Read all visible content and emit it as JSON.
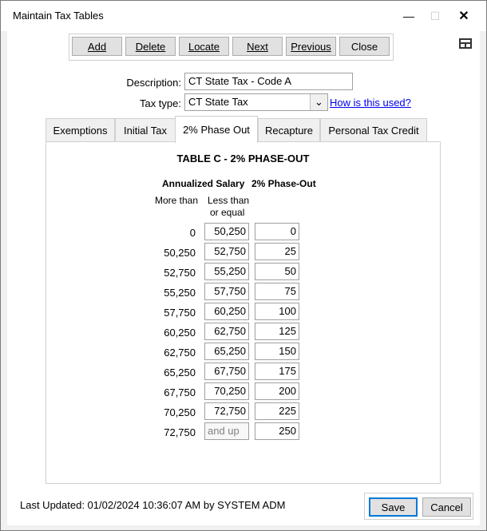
{
  "window": {
    "title": "Maintain Tax Tables"
  },
  "toolbar": {
    "add": "Add",
    "delete": "Delete",
    "locate": "Locate",
    "next": "Next",
    "previous": "Previous",
    "close": "Close"
  },
  "form": {
    "description_label": "Description:",
    "description_value": "CT State Tax - Code A",
    "tax_type_label": "Tax type:",
    "tax_type_value": "CT State Tax",
    "help_link": "How is this used?"
  },
  "tabs": [
    {
      "label": "Exemptions",
      "active": false
    },
    {
      "label": "Initial Tax",
      "active": false
    },
    {
      "label": "2% Phase Out",
      "active": true
    },
    {
      "label": "Recapture",
      "active": false
    },
    {
      "label": "Personal Tax Credit",
      "active": false
    }
  ],
  "table": {
    "title": "TABLE C - 2% PHASE-OUT",
    "col_annualized_salary": "Annualized Salary",
    "col_phase_out": "2% Phase-Out",
    "col_more_than": "More than",
    "col_less_than_1": "Less than",
    "col_less_than_2": "or equal",
    "rows": [
      {
        "more_than": "0",
        "less_than": "50,250",
        "phase_out": "0"
      },
      {
        "more_than": "50,250",
        "less_than": "52,750",
        "phase_out": "25"
      },
      {
        "more_than": "52,750",
        "less_than": "55,250",
        "phase_out": "50"
      },
      {
        "more_than": "55,250",
        "less_than": "57,750",
        "phase_out": "75"
      },
      {
        "more_than": "57,750",
        "less_than": "60,250",
        "phase_out": "100"
      },
      {
        "more_than": "60,250",
        "less_than": "62,750",
        "phase_out": "125"
      },
      {
        "more_than": "62,750",
        "less_than": "65,250",
        "phase_out": "150"
      },
      {
        "more_than": "65,250",
        "less_than": "67,750",
        "phase_out": "175"
      },
      {
        "more_than": "67,750",
        "less_than": "70,250",
        "phase_out": "200"
      },
      {
        "more_than": "70,250",
        "less_than": "72,750",
        "phase_out": "225"
      },
      {
        "more_than": "72,750",
        "less_than": "and up",
        "phase_out": "250"
      }
    ]
  },
  "footer": {
    "last_updated": "Last Updated: 01/02/2024 10:36:07 AM by SYSTEM ADM",
    "save": "Save",
    "cancel": "Cancel"
  }
}
